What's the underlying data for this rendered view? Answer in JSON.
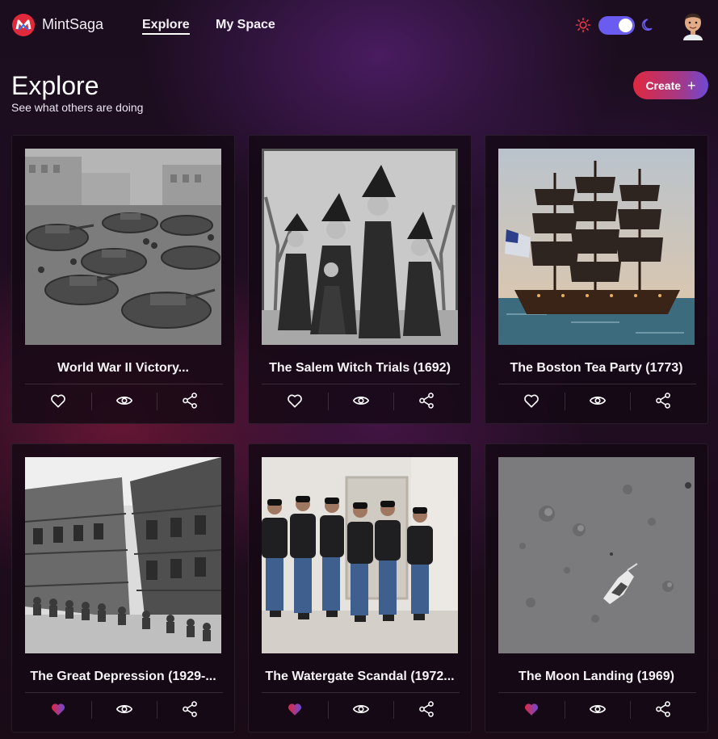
{
  "app": {
    "brand": "MintSaga",
    "nav": [
      {
        "label": "Explore",
        "active": true
      },
      {
        "label": "My Space",
        "active": false
      }
    ],
    "theme": "dark",
    "accent": "#6a5cf0"
  },
  "header": {
    "title": "Explore",
    "subtitle": "See what others are doing",
    "create_label": "Create"
  },
  "cards": [
    {
      "title": "World War II Victory...",
      "liked": false
    },
    {
      "title": "The Salem Witch Trials (1692)",
      "liked": false
    },
    {
      "title": "The Boston Tea Party (1773)",
      "liked": false
    },
    {
      "title": "The Great Depression (1929-...",
      "liked": true
    },
    {
      "title": "The Watergate Scandal (1972...",
      "liked": true
    },
    {
      "title": "The Moon Landing (1969)",
      "liked": true
    }
  ],
  "icons": {
    "like": "heart-icon",
    "view": "eye-icon",
    "share": "share-icon"
  }
}
